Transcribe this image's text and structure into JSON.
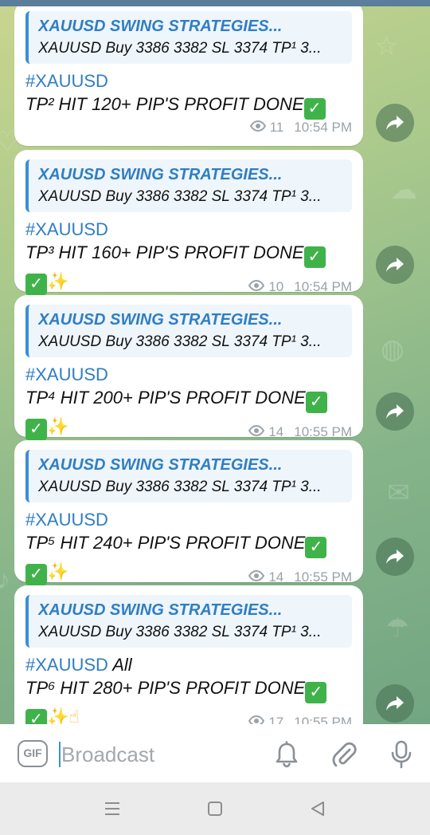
{
  "chat": {
    "messages": [
      {
        "reply_title": "XAUUSD SWING STRATEGIES...",
        "reply_text": "XAUUSD Buy 3386 3382 SL   3374 TP¹ 3...",
        "hashtag": "#XAUUSD",
        "hashtag_extra": "",
        "text": "TP² HIT 120+ PIP'S PROFIT DONE",
        "emoji_line": false,
        "hand": false,
        "views": "11",
        "time": "10:54 PM"
      },
      {
        "reply_title": "XAUUSD SWING STRATEGIES...",
        "reply_text": "XAUUSD Buy 3386 3382 SL   3374 TP¹ 3...",
        "hashtag": "#XAUUSD",
        "hashtag_extra": "",
        "text": "TP³ HIT 160+ PIP'S PROFIT DONE",
        "emoji_line": true,
        "hand": false,
        "views": "10",
        "time": "10:54 PM"
      },
      {
        "reply_title": "XAUUSD SWING STRATEGIES...",
        "reply_text": "XAUUSD Buy 3386 3382 SL   3374 TP¹ 3...",
        "hashtag": "#XAUUSD",
        "hashtag_extra": "",
        "text": "TP⁴ HIT 200+ PIP'S PROFIT DONE",
        "emoji_line": true,
        "hand": false,
        "views": "14",
        "time": "10:55 PM"
      },
      {
        "reply_title": "XAUUSD SWING STRATEGIES...",
        "reply_text": "XAUUSD Buy 3386 3382 SL   3374 TP¹ 3...",
        "hashtag": "#XAUUSD",
        "hashtag_extra": "",
        "text": "TP⁵ HIT 240+ PIP'S PROFIT DONE",
        "emoji_line": true,
        "hand": false,
        "views": "14",
        "time": "10:55 PM"
      },
      {
        "reply_title": "XAUUSD SWING STRATEGIES...",
        "reply_text": "XAUUSD Buy 3386 3382 SL   3374 TP¹ 3...",
        "hashtag": "#XAUUSD",
        "hashtag_extra": " All",
        "text": "TP⁶ HIT 280+ PIP'S PROFIT DONE",
        "emoji_line": true,
        "hand": true,
        "views": "17",
        "time": "10:55 PM"
      }
    ]
  },
  "icons": {
    "forward": "share-forward-icon",
    "views": "eye-icon",
    "gif": "gif-icon",
    "bell": "bell-icon",
    "attach": "paperclip-icon",
    "mic": "microphone-icon",
    "nav_menu": "menu-lines-icon",
    "nav_home": "square-home-icon",
    "nav_back": "triangle-back-icon"
  },
  "composer": {
    "gif_label": "GIF",
    "placeholder": "Broadcast"
  },
  "colors": {
    "accent": "#3a8fd6",
    "link": "#2f7ec3",
    "meta": "#9aa2a9",
    "check": "#3fb34a"
  }
}
